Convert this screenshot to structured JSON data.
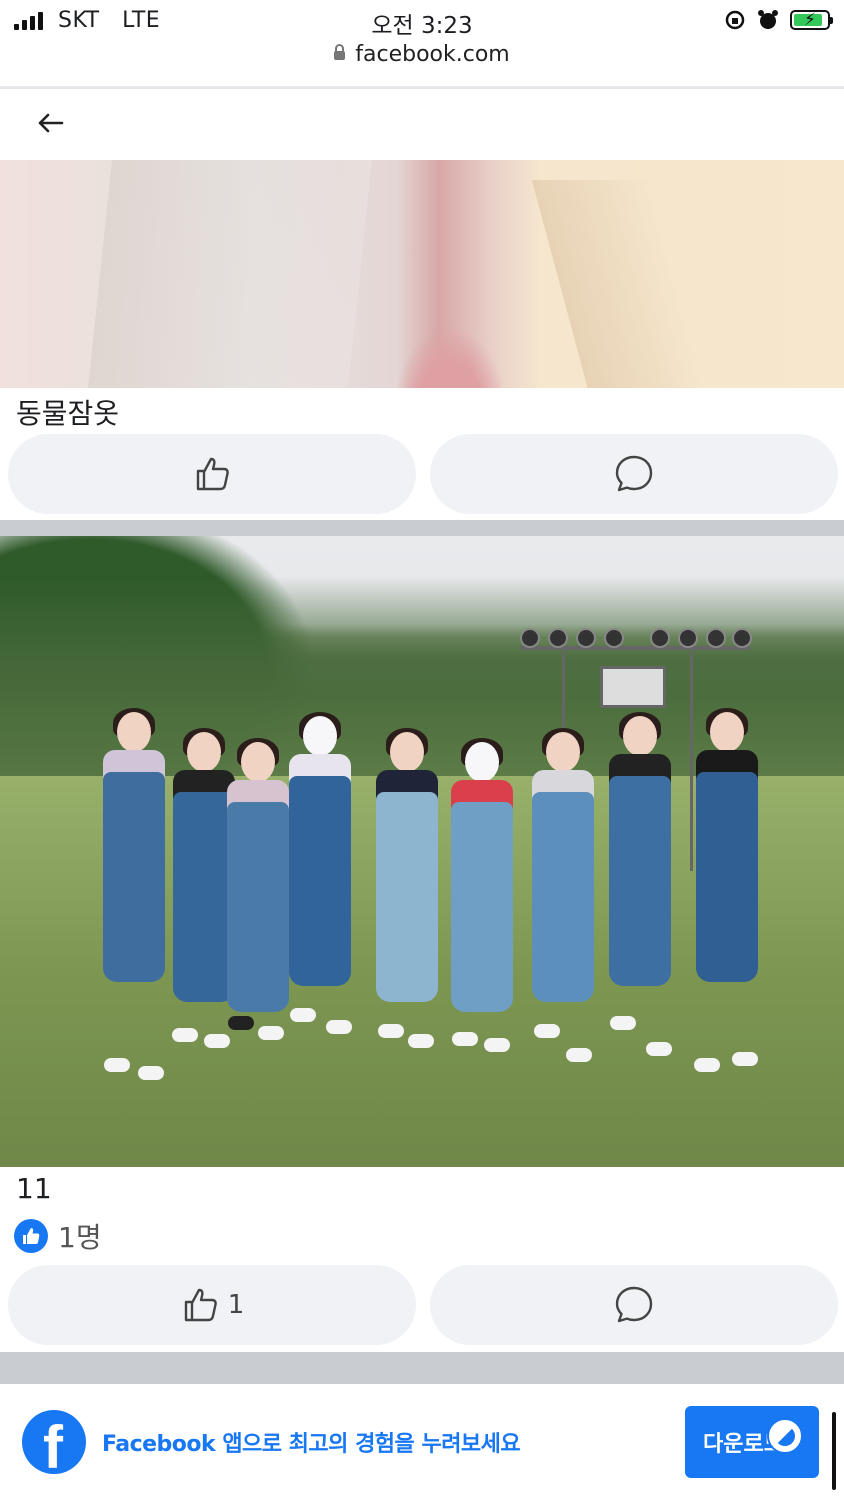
{
  "status_bar": {
    "carrier": "SKT",
    "network": "LTE",
    "time": "오전 3:23"
  },
  "url_bar": {
    "url": "facebook.com"
  },
  "posts": [
    {
      "caption": "동물잠옷"
    },
    {
      "caption": "11",
      "reactions_text": "1명",
      "like_count": "1"
    }
  ],
  "icons": {
    "back": "back-arrow-icon",
    "like": "thumbs-up-icon",
    "comment": "comment-bubble-icon",
    "lock": "lock-icon"
  },
  "app_banner": {
    "message": "Facebook 앱으로 최고의 경험을 누려보세요",
    "download_label": "다운로드"
  },
  "colors": {
    "brand": "#1877f2",
    "button_bg": "#f0f2f5",
    "divider": "#c9ccd1"
  }
}
